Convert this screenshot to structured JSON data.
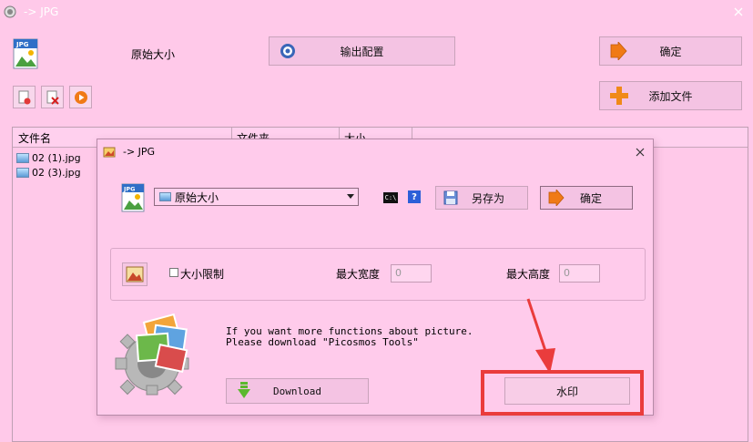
{
  "window": {
    "title": "-> JPG"
  },
  "main": {
    "size_label": "原始大小",
    "output_config_label": "输出配置",
    "ok_label": "确定",
    "add_file_label": "添加文件",
    "columns": [
      "文件名",
      "文件夹",
      "大小"
    ],
    "files": [
      "02 (1).jpg",
      "02 (3).jpg"
    ]
  },
  "dialog": {
    "title": "-> JPG",
    "size_select": "原始大小",
    "cli_label": "C:\\",
    "help_label": "?",
    "save_as_label": "另存为",
    "ok_label": "确定",
    "size_limit_label": "大小限制",
    "max_width_label": "最大宽度",
    "max_width_value": "0",
    "max_height_label": "最大高度",
    "max_height_value": "0",
    "info_line1": "If you want more functions about picture.",
    "info_line2": "Please download \"Picosmos Tools\"",
    "download_label": "Download",
    "watermark_label": "水印"
  },
  "colors": {
    "background": "#ffc9e9",
    "button": "#f4c3e3",
    "highlight": "#ea3c3c",
    "accent_orange": "#f07a16"
  }
}
